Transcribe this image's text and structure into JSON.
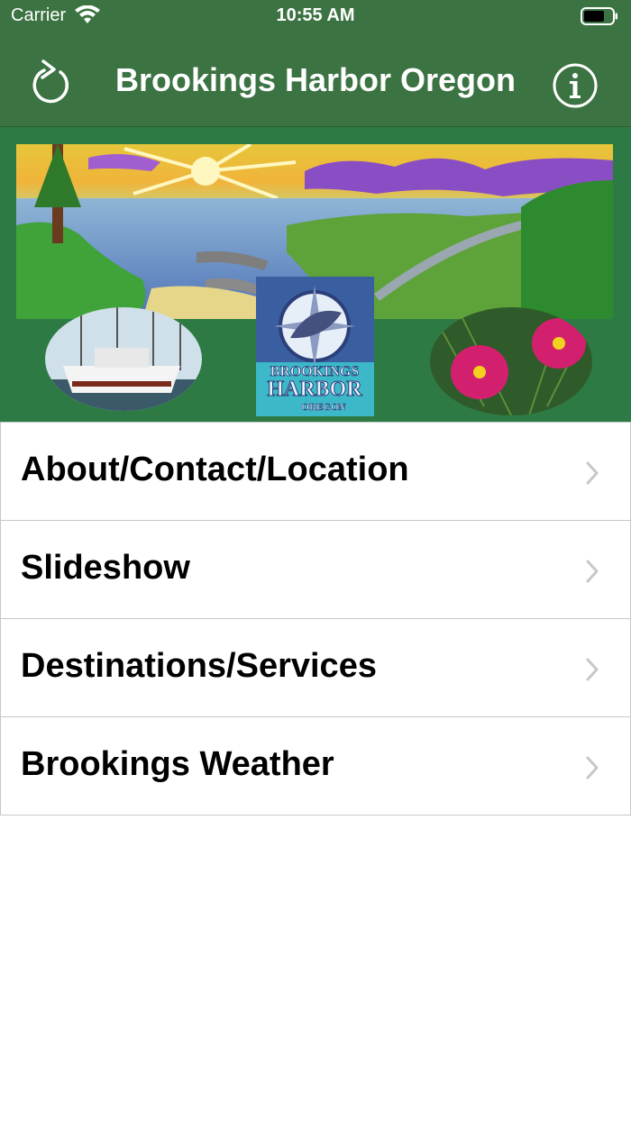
{
  "status_bar": {
    "carrier": "Carrier",
    "time": "10:55 AM"
  },
  "nav": {
    "title": "Brookings Harbor Oregon",
    "refresh_icon": "refresh-icon",
    "info_icon": "info-icon"
  },
  "banner": {
    "logo_line1": "BROOKINGS",
    "logo_line2": "HARBOR",
    "logo_line3": "OREGON"
  },
  "menu": {
    "items": [
      {
        "label": "About/Contact/Location"
      },
      {
        "label": "Slideshow"
      },
      {
        "label": "Destinations/Services"
      },
      {
        "label": "Brookings Weather"
      }
    ]
  },
  "colors": {
    "nav_bg": "#3c7342",
    "banner_bg": "#2e7a44",
    "chevron": "#c7c7cc"
  }
}
